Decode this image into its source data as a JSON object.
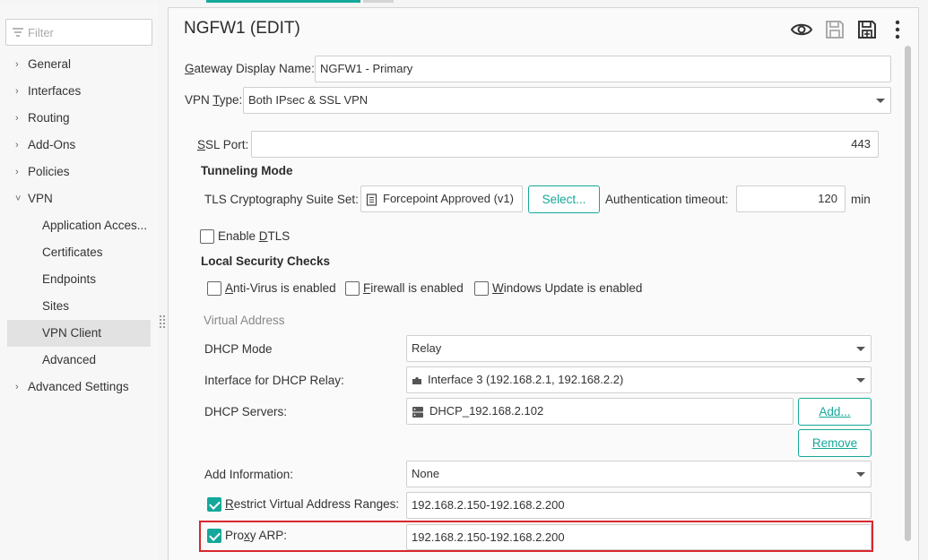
{
  "sidebar": {
    "filter_placeholder": "Filter",
    "items": [
      {
        "label": "General",
        "chevron": "›"
      },
      {
        "label": "Interfaces",
        "chevron": "›"
      },
      {
        "label": "Routing",
        "chevron": "›"
      },
      {
        "label": "Add-Ons",
        "chevron": "›"
      },
      {
        "label": "Policies",
        "chevron": "›"
      },
      {
        "label": "VPN",
        "chevron": "˅"
      },
      {
        "label": "Application Acces..."
      },
      {
        "label": "Certificates"
      },
      {
        "label": "Endpoints"
      },
      {
        "label": "Sites"
      },
      {
        "label": "VPN Client"
      },
      {
        "label": "Advanced"
      },
      {
        "label": "Advanced Settings",
        "chevron": "›"
      }
    ]
  },
  "panel": {
    "title": "NGFW1 (EDIT)",
    "gateway_display_name": {
      "label_pre": "",
      "label_u": "G",
      "label_post": "ateway Display Name:",
      "value": "NGFW1 - Primary"
    },
    "vpn_type": {
      "label_pre": "VPN ",
      "label_u": "T",
      "label_post": "ype:",
      "value": "Both IPsec & SSL VPN"
    },
    "ssl_port": {
      "label_pre": "",
      "label_u": "S",
      "label_post": "SL Port:",
      "value": "443"
    },
    "tunneling_mode": "Tunneling Mode",
    "tls_suite": {
      "label": "TLS Cryptography Suite Set:",
      "value": "Forcepoint Approved (v1)",
      "button": "Select..."
    },
    "auth_timeout": {
      "label": "Authentication timeout:",
      "value": "120",
      "unit": "min"
    },
    "enable_dtls": {
      "label_pre": "Enable ",
      "label_u": "D",
      "label_post": "TLS",
      "checked": false
    },
    "local_security_checks": "Local Security Checks",
    "antivirus": {
      "label_u": "A",
      "label_post": "nti-Virus is enabled",
      "checked": false
    },
    "firewall": {
      "label_u": "F",
      "label_post": "irewall is enabled",
      "checked": false
    },
    "windows_update": {
      "label_u": "W",
      "label_post": "indows Update is enabled",
      "checked": false
    },
    "virtual_address": "Virtual Address",
    "dhcp_mode": {
      "label": "DHCP Mode",
      "value": "Relay"
    },
    "dhcp_relay_interface": {
      "label": "Interface for DHCP Relay:",
      "value": "Interface 3 (192.168.2.1, 192.168.2.2)"
    },
    "dhcp_servers": {
      "label": "DHCP Servers:",
      "value": "DHCP_192.168.2.102",
      "add_button": "Add...",
      "remove_button": "Remove"
    },
    "add_information": {
      "label": "Add Information:",
      "value": "None"
    },
    "restrict_ranges": {
      "label_u": "R",
      "label_post": "estrict Virtual Address Ranges:",
      "value": "192.168.2.150-192.168.2.200",
      "checked": true
    },
    "proxy_arp": {
      "label_pre": "Pro",
      "label_u": "x",
      "label_post": "y ARP:",
      "value": "192.168.2.150-192.168.2.200",
      "checked": true
    }
  },
  "colors": {
    "accent": "#14a89a",
    "highlight": "#d9262e"
  }
}
